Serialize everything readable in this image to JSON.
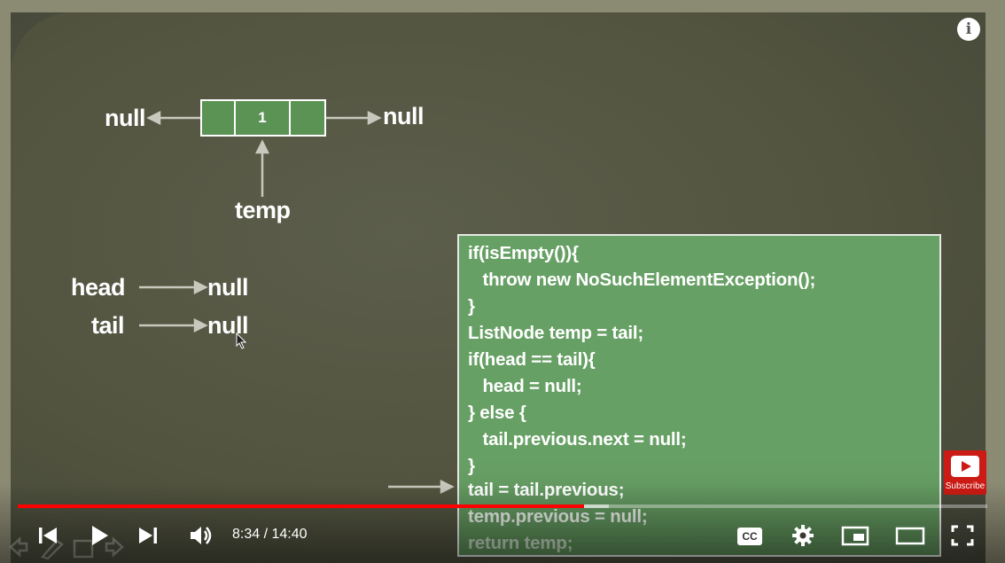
{
  "diagram": {
    "node_value": "1",
    "left_null": "null",
    "right_null": "null",
    "temp_label": "temp",
    "head_label": "head",
    "head_null": "null",
    "tail_label": "tail",
    "tail_null": "null"
  },
  "code": {
    "lines": [
      "if(isEmpty()){",
      "   throw new NoSuchElementException();",
      "}",
      "ListNode temp = tail;",
      "if(head == tail){",
      "   head = null;",
      "} else {",
      "   tail.previous.next = null;",
      "}",
      "tail = tail.previous;",
      "temp.previous = null;",
      "return temp;"
    ],
    "highlighted_line_index": 9
  },
  "subscribe": {
    "label": "Subscribe"
  },
  "player": {
    "current_time": "8:34",
    "duration": "14:40",
    "time_display": "8:34 / 14:40",
    "played_fraction": 0.584,
    "buffered_fraction": 0.61,
    "icons": [
      "info-icon",
      "previous-icon",
      "play-icon",
      "next-icon",
      "volume-icon",
      "captions-icon",
      "settings-icon",
      "miniplayer-icon",
      "theater-icon",
      "fullscreen-icon"
    ],
    "captions_label": "CC",
    "accent": "#ff0000"
  },
  "colors": {
    "board": "#52543f",
    "code_box": "#67a065",
    "node_fill": "#5b9355",
    "subscribe": "#cc1b14"
  }
}
